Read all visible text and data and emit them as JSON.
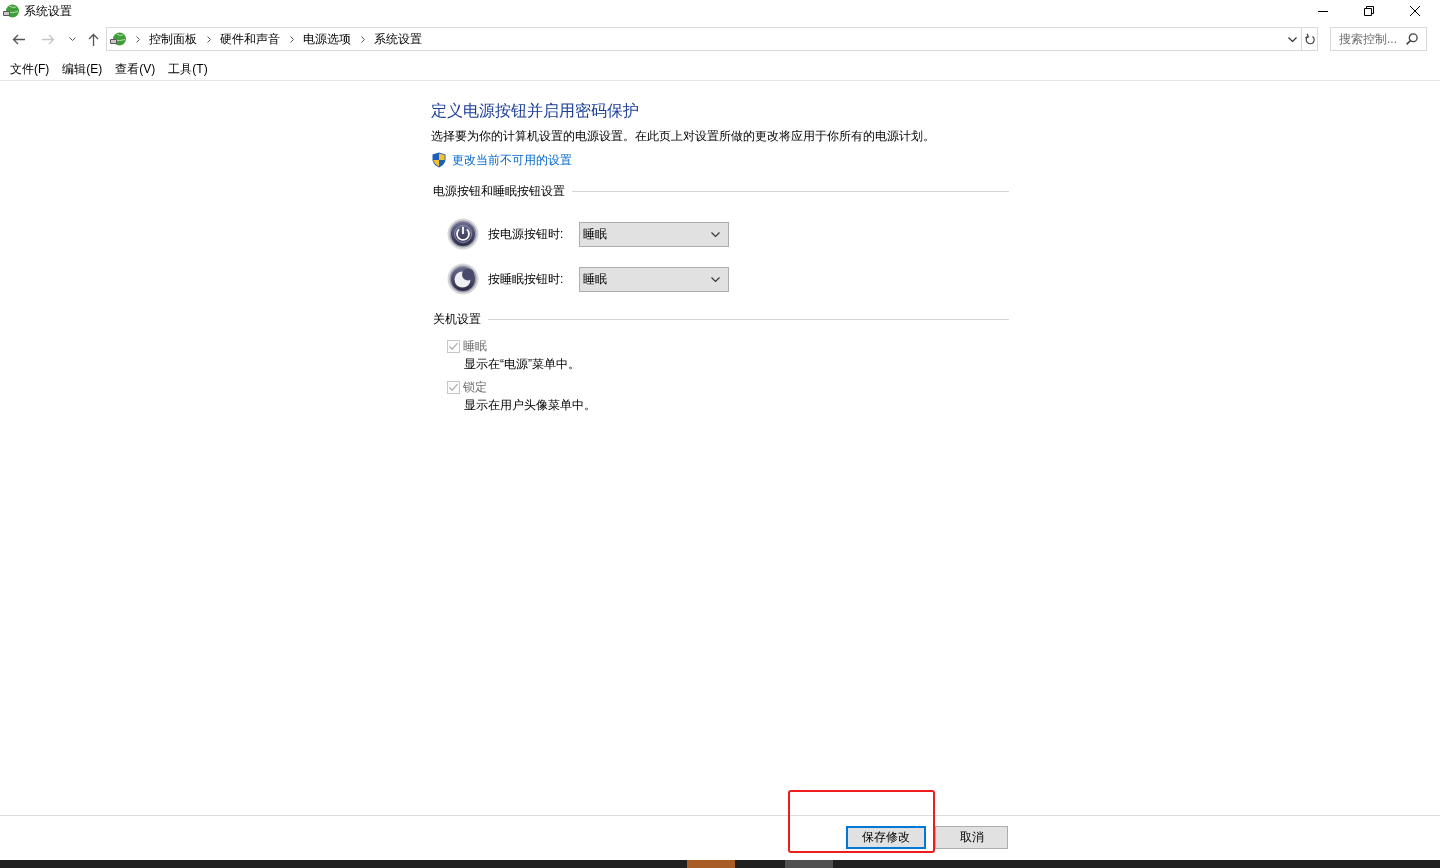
{
  "window": {
    "title": "系统设置"
  },
  "nav_buttons": [
    {
      "kind": "back",
      "disabled": false
    },
    {
      "kind": "forward",
      "disabled": true
    },
    {
      "kind": "recent",
      "disabled": false
    },
    {
      "kind": "up",
      "disabled": false
    }
  ],
  "address_bar": {
    "breadcrumbs": [
      "控制面板",
      "硬件和声音",
      "电源选项",
      "系统设置"
    ]
  },
  "search": {
    "placeholder": "搜索控制..."
  },
  "menu": [
    "文件(F)",
    "编辑(E)",
    "查看(V)",
    "工具(T)"
  ],
  "page": {
    "heading": "定义电源按钮并启用密码保护",
    "description": "选择要为你的计算机设置的电源设置。在此页上对设置所做的更改将应用于你所有的电源计划。",
    "admin_link": "更改当前不可用的设置"
  },
  "sections": [
    {
      "title": "电源按钮和睡眠按钮设置",
      "kind": "actions",
      "rows": [
        {
          "kind": "power",
          "label": "按电源按钮时:",
          "value": "睡眠"
        },
        {
          "kind": "sleep",
          "label": "按睡眠按钮时:",
          "value": "睡眠"
        }
      ]
    },
    {
      "title": "关机设置",
      "kind": "checkboxes",
      "items": [
        {
          "label": "睡眠",
          "note": "显示在“电源”菜单中。",
          "checked": true,
          "disabled": true
        },
        {
          "label": "锁定",
          "note": "显示在用户头像菜单中。",
          "checked": true,
          "disabled": true
        }
      ]
    }
  ],
  "buttons": [
    {
      "label": "保存修改",
      "default": true,
      "highlighted": true
    },
    {
      "label": "取消",
      "default": false,
      "highlighted": false
    }
  ]
}
